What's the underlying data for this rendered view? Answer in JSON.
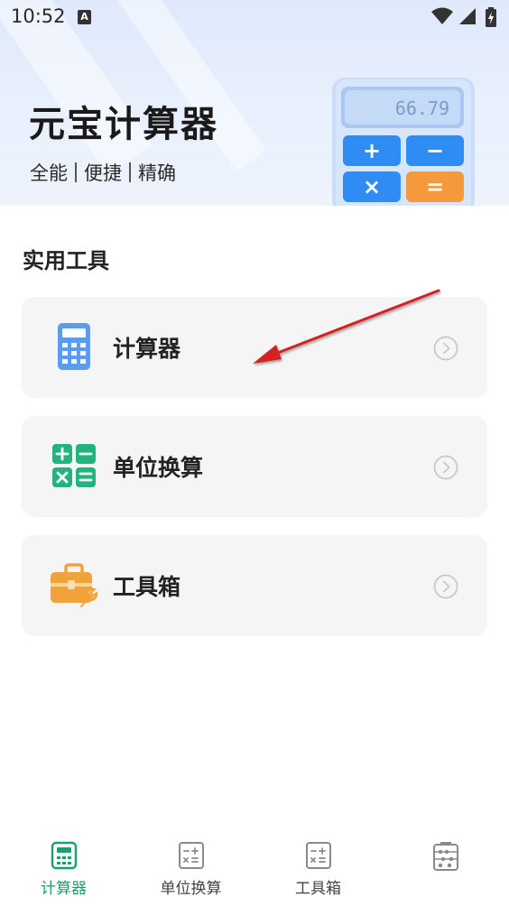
{
  "status_bar": {
    "time": "10:52",
    "notification_icon": "A"
  },
  "header": {
    "title": "元宝计算器",
    "tagline": [
      "全能",
      "便捷",
      "精确"
    ],
    "illustration": {
      "display_value": "66.79",
      "keys": [
        "+",
        "−",
        "×",
        "="
      ]
    }
  },
  "section": {
    "title": "实用工具"
  },
  "tools": [
    {
      "label": "计算器",
      "icon": "calculator-icon"
    },
    {
      "label": "单位换算",
      "icon": "unit-conversion-icon"
    },
    {
      "label": "工具箱",
      "icon": "toolbox-icon"
    }
  ],
  "bottom_nav": {
    "items": [
      {
        "label": "计算器",
        "icon": "calculator-icon",
        "active": true
      },
      {
        "label": "单位换算",
        "icon": "unit-conversion-icon",
        "active": false
      },
      {
        "label": "工具箱",
        "icon": "toolbox-icon",
        "active": false
      },
      {
        "label": "",
        "icon": "abacus-icon",
        "active": false
      }
    ]
  },
  "colors": {
    "accent_green": "#1aa06a",
    "calculator_blue": "#5b9cf0",
    "unit_teal": "#22b37f",
    "toolbox_orange": "#f2a23a",
    "annotation_red": "#d42020"
  }
}
